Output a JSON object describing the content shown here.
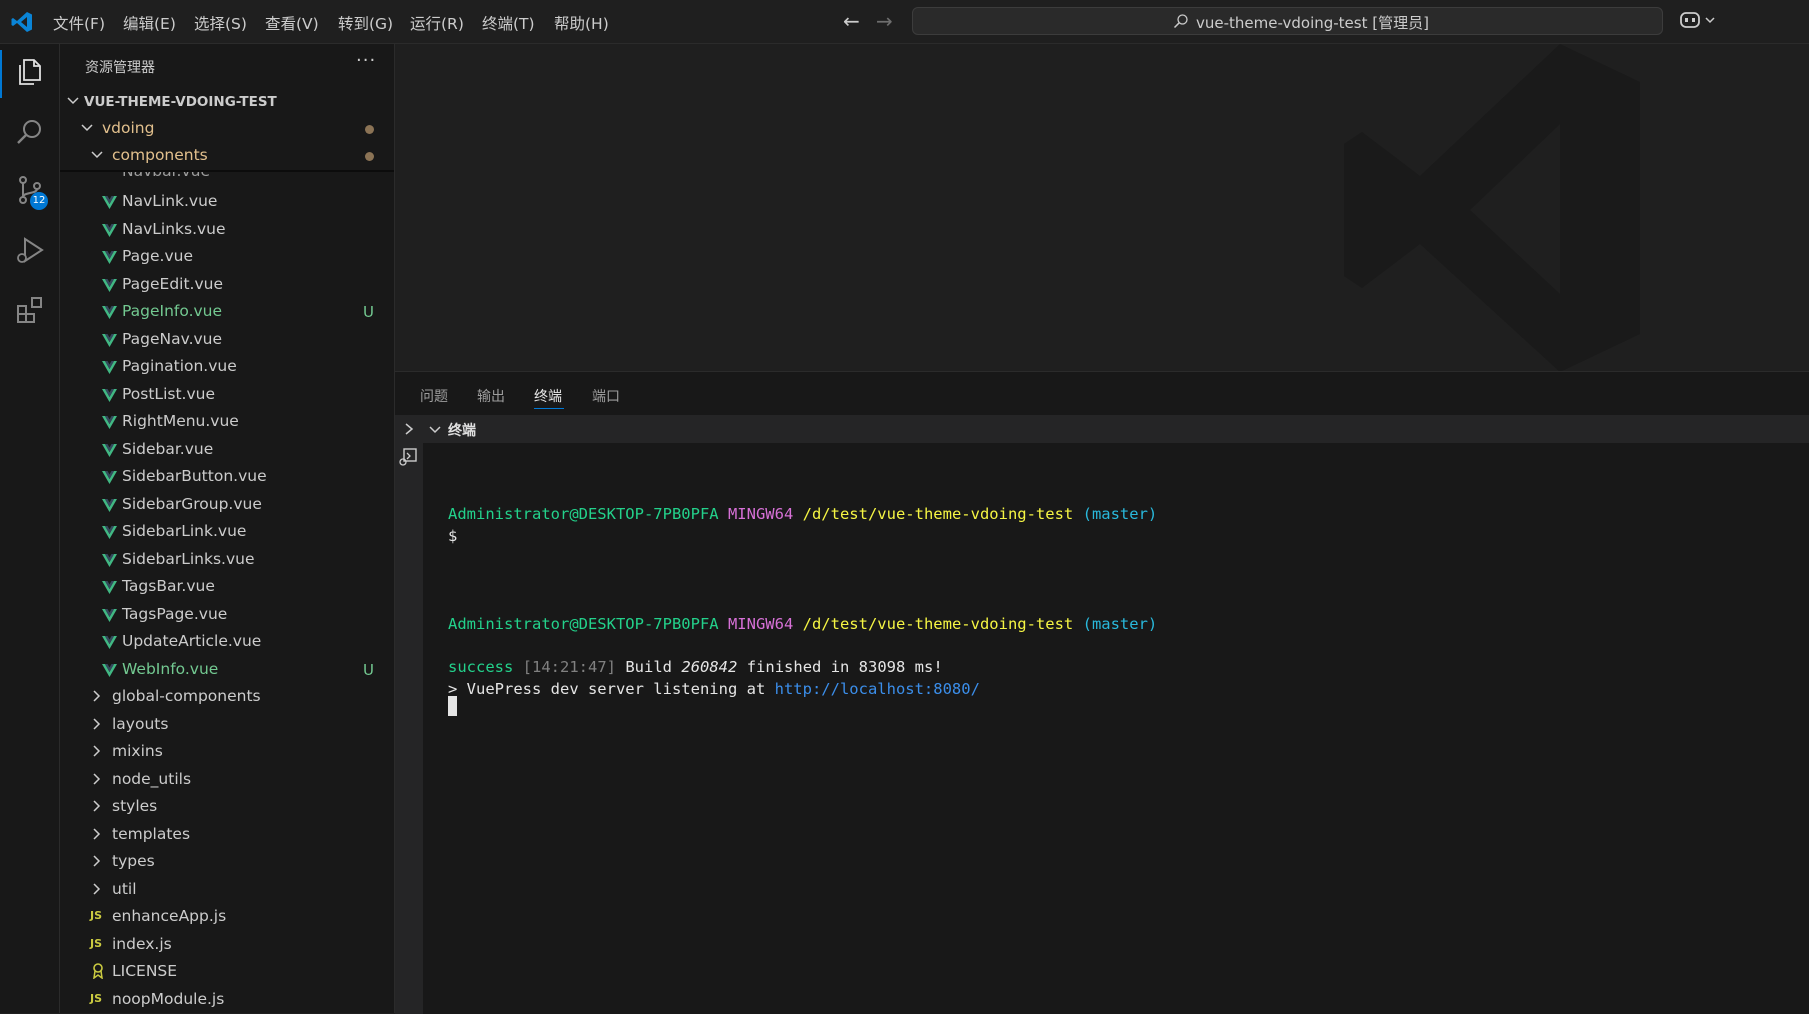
{
  "titlebar": {
    "menu": [
      "文件(F)",
      "编辑(E)",
      "选择(S)",
      "查看(V)",
      "转到(G)",
      "运行(R)",
      "终端(T)",
      "帮助(H)"
    ],
    "command_center_text": "vue-theme-vdoing-test [管理员]"
  },
  "activitybar": {
    "items": [
      "files-icon",
      "search-icon",
      "source-control-icon",
      "run-debug-icon",
      "extensions-icon"
    ],
    "scm_badge": "12",
    "accent_color": "#0078d4"
  },
  "sidebar": {
    "title": "资源管理器",
    "more": "···",
    "root": "VUE-THEME-VDOING-TEST",
    "folder_vdoing": "vdoing",
    "folder_components": "components",
    "partial_file": "Navbar.vue",
    "component_files": [
      {
        "name": "NavLink.vue",
        "status": ""
      },
      {
        "name": "NavLinks.vue",
        "status": ""
      },
      {
        "name": "Page.vue",
        "status": ""
      },
      {
        "name": "PageEdit.vue",
        "status": ""
      },
      {
        "name": "PageInfo.vue",
        "status": "U"
      },
      {
        "name": "PageNav.vue",
        "status": ""
      },
      {
        "name": "Pagination.vue",
        "status": ""
      },
      {
        "name": "PostList.vue",
        "status": ""
      },
      {
        "name": "RightMenu.vue",
        "status": ""
      },
      {
        "name": "Sidebar.vue",
        "status": ""
      },
      {
        "name": "SidebarButton.vue",
        "status": ""
      },
      {
        "name": "SidebarGroup.vue",
        "status": ""
      },
      {
        "name": "SidebarLink.vue",
        "status": ""
      },
      {
        "name": "SidebarLinks.vue",
        "status": ""
      },
      {
        "name": "TagsBar.vue",
        "status": ""
      },
      {
        "name": "TagsPage.vue",
        "status": ""
      },
      {
        "name": "UpdateArticle.vue",
        "status": ""
      },
      {
        "name": "WebInfo.vue",
        "status": "U"
      }
    ],
    "folders": [
      "global-components",
      "layouts",
      "mixins",
      "node_utils",
      "styles",
      "templates",
      "types",
      "util"
    ],
    "root_files": [
      {
        "name": "enhanceApp.js",
        "icon": "JS"
      },
      {
        "name": "index.js",
        "icon": "JS"
      },
      {
        "name": "LICENSE",
        "icon": "license-icon"
      },
      {
        "name": "noopModule.js",
        "icon": "JS"
      }
    ],
    "untracked_color": "#73c991",
    "vue_icon_color": "#41b883"
  },
  "panel": {
    "tabs": [
      "问题",
      "输出",
      "终端",
      "端口"
    ],
    "active_tab": "终端",
    "terminal_header": "终端",
    "prompt1": {
      "user": "Administrator@DESKTOP-7PB0PFA",
      "env": "MINGW64",
      "path": "/d/test/vue-theme-vdoing-test",
      "branch": "(master)"
    },
    "dollar": "$",
    "prompt2": {
      "user": "Administrator@DESKTOP-7PB0PFA",
      "env": "MINGW64",
      "path": "/d/test/vue-theme-vdoing-test",
      "branch": "(master)"
    },
    "success_word": "success",
    "time": "[14:21:47]",
    "build_word": "Build",
    "build_id": "260842",
    "build_rest": "finished in 83098 ms!",
    "server_prefix": "> VuePress dev server listening at",
    "server_url": "http://localhost:8080/"
  }
}
